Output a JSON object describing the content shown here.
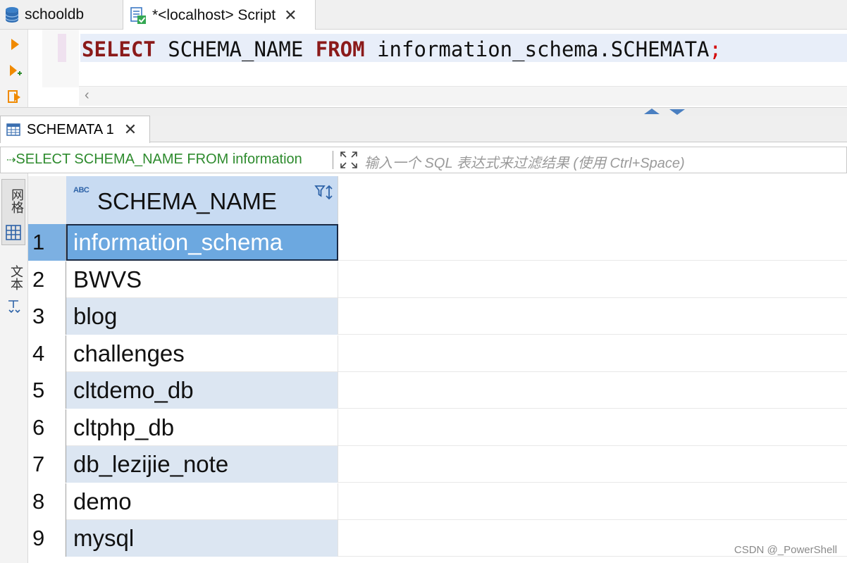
{
  "tabs": [
    {
      "label": "schooldb"
    },
    {
      "label": "*<localhost> Script",
      "active": true
    }
  ],
  "editor": {
    "tokens": {
      "select": "SELECT",
      "column": "SCHEMA_NAME",
      "from": "FROM",
      "table": "information_schema.SCHEMATA",
      "semicolon": ";"
    }
  },
  "results": {
    "tab_label": "SCHEMATA 1",
    "query_text": "SELECT SCHEMA_NAME FROM information",
    "filter_placeholder": "输入一个 SQL 表达式来过滤结果 (使用 Ctrl+Space)",
    "side_tools": {
      "grid_label": "网格",
      "text_label": "文本"
    },
    "type_badge": "ABC",
    "column_header": "SCHEMA_NAME",
    "rows": [
      {
        "num": "1",
        "value": "information_schema"
      },
      {
        "num": "2",
        "value": "BWVS"
      },
      {
        "num": "3",
        "value": "blog"
      },
      {
        "num": "4",
        "value": "challenges"
      },
      {
        "num": "5",
        "value": "cltdemo_db"
      },
      {
        "num": "6",
        "value": "cltphp_db"
      },
      {
        "num": "7",
        "value": "db_lezijie_note"
      },
      {
        "num": "8",
        "value": "demo"
      },
      {
        "num": "9",
        "value": "mysql"
      }
    ],
    "selected_row": 1
  },
  "watermark": "CSDN @_PowerShell",
  "colors": {
    "keyword": "#8b1a1a",
    "selection": "#6ca8e0",
    "alt_row": "#dce6f2",
    "header": "#c8dbf2",
    "query_green": "#2e8b2e"
  }
}
